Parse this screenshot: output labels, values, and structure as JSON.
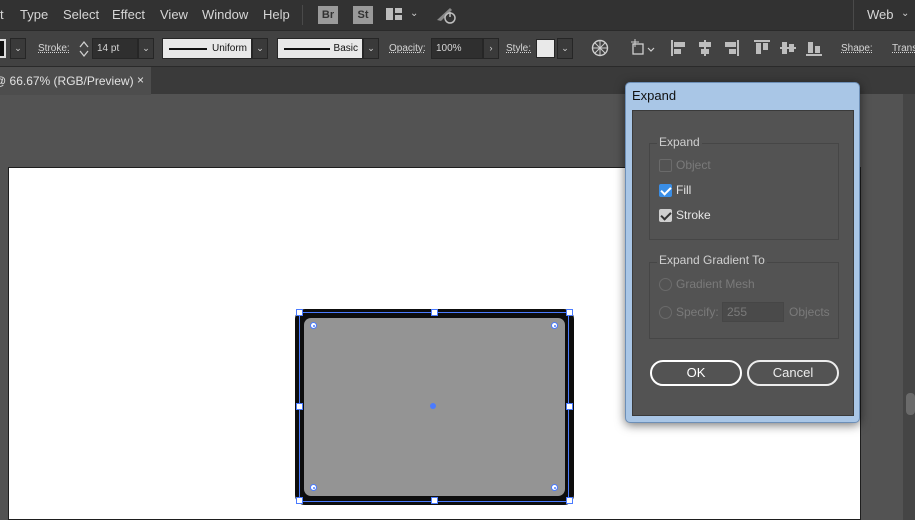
{
  "menu": {
    "items": [
      "t",
      "Type",
      "Select",
      "Effect",
      "View",
      "Window",
      "Help"
    ],
    "bridge_label": "Br",
    "stock_label": "St",
    "workspace": "Web"
  },
  "control": {
    "stroke_label": "Stroke:",
    "stroke_weight": "14 pt",
    "profile": "Uniform",
    "brush": "Basic",
    "opacity_label": "Opacity:",
    "opacity_value": "100%",
    "style_label": "Style:",
    "shape_label": "Shape:",
    "transform_label": "Trans"
  },
  "document": {
    "tab_title": "@ 66.67% (RGB/Preview)",
    "close_glyph": "×"
  },
  "dialog": {
    "title": "Expand",
    "expand_group": "Expand",
    "object_label": "Object",
    "object_checked": false,
    "fill_label": "Fill",
    "fill_checked": true,
    "stroke_label": "Stroke",
    "stroke_checked": true,
    "gradient_group": "Expand Gradient To",
    "gradient_mesh_label": "Gradient Mesh",
    "specify_label": "Specify:",
    "specify_value": "255",
    "objects_label": "Objects",
    "ok_label": "OK",
    "cancel_label": "Cancel"
  },
  "colors": {
    "selection": "#4a7bff",
    "shape_fill": "#949494",
    "shape_stroke": "#0d0d0d",
    "dialog_frame": "#a9c6e6"
  }
}
